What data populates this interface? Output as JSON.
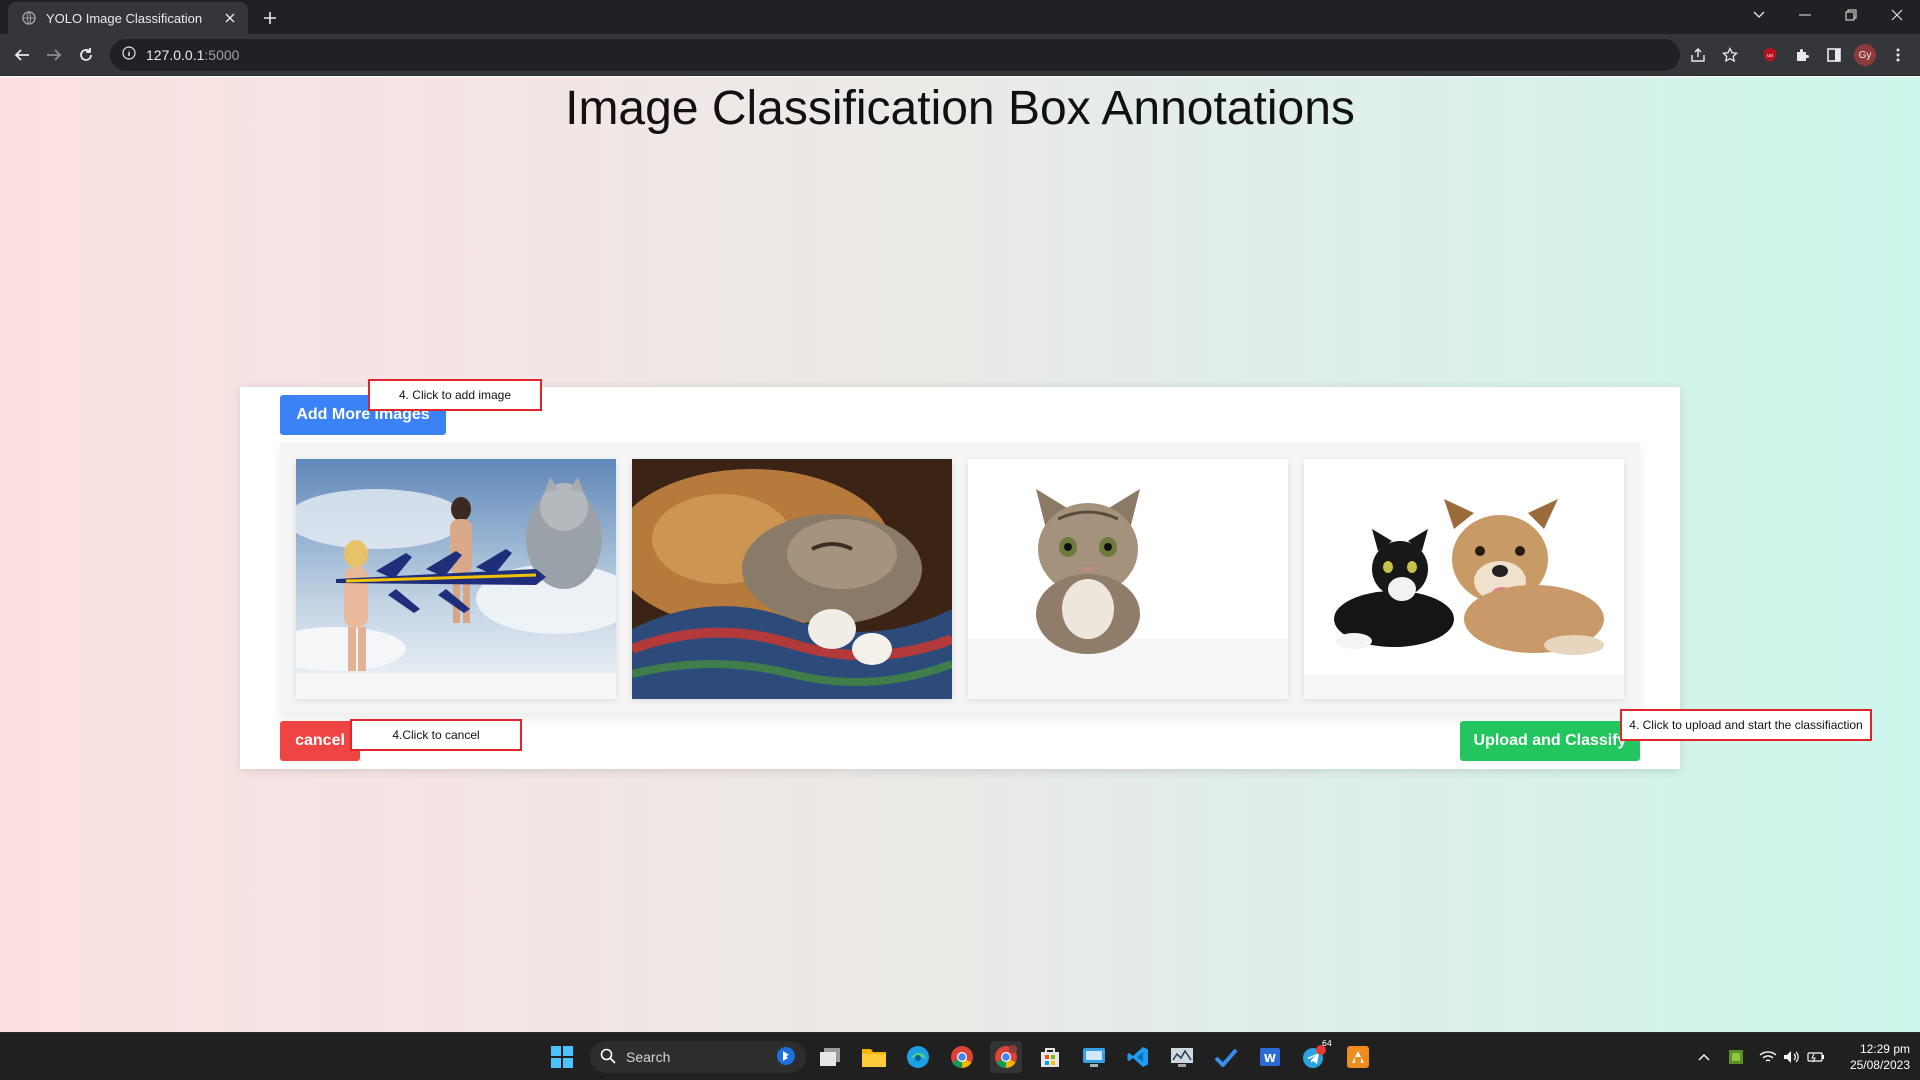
{
  "browser": {
    "tab_title": "YOLO Image Classification",
    "url_host": "127.0.0.1",
    "url_port": ":5000",
    "profile_initials": "Gy"
  },
  "page": {
    "title": "Image Classification Box Annotations",
    "add_button": "Add More Images",
    "cancel_button": "cancel",
    "upload_button": "Upload and Classify",
    "images": [
      {
        "name": "collage: women, jets and cat"
      },
      {
        "name": "dog and cat sleeping on blanket"
      },
      {
        "name": "tabby kitten"
      },
      {
        "name": "cat and dog lying together"
      }
    ]
  },
  "annotations": {
    "add": "4. Click to add image",
    "cancel": "4.Click to cancel",
    "upload": "4. Click to upload and start the classifiaction"
  },
  "taskbar": {
    "search_label": "Search",
    "time": "12:29 pm",
    "date": "25/08/2023",
    "telegram_badge": "64"
  },
  "colors": {
    "add_button": "#3b82f6",
    "cancel_button": "#ef4444",
    "upload_button": "#22c55e",
    "annotation_border": "#e0262c"
  }
}
